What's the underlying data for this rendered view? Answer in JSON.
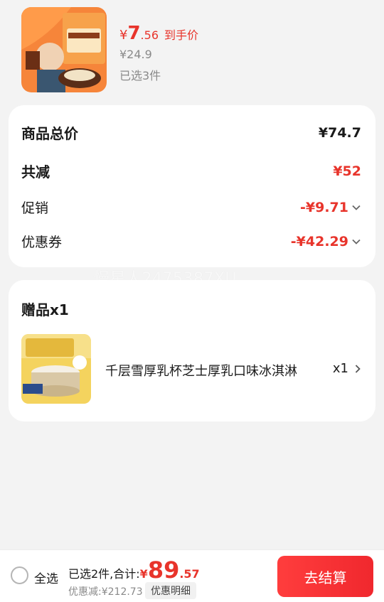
{
  "product": {
    "price_yen": "¥",
    "price_int": "7",
    "price_dec": ".56",
    "price_tag": "到手价",
    "original_price": "¥24.9",
    "selected_count": "已选3件"
  },
  "summary": {
    "total_label": "商品总价",
    "total_value": "¥74.7",
    "reduce_label": "共减",
    "reduce_value": "¥52",
    "promo_label": "促销",
    "promo_value": "-¥9.71",
    "coupon_label": "优惠券",
    "coupon_value": "-¥42.29"
  },
  "watermark": "慢星人2475387XU",
  "gift": {
    "title": "赠品x1",
    "name": "千层雪厚乳杯芝士厚乳口味冰淇淋",
    "quantity": "x1"
  },
  "bottom": {
    "select_all": "全选",
    "summary_prefix": "已选2件,合计:",
    "total_yen": "¥",
    "total_int": "89",
    "total_dec": ".57",
    "discount_text": "优惠减:¥212.73",
    "detail_label": "优惠明细",
    "checkout_label": "去结算"
  },
  "colors": {
    "accent": "#e8342b",
    "background": "#f3f3f3"
  }
}
